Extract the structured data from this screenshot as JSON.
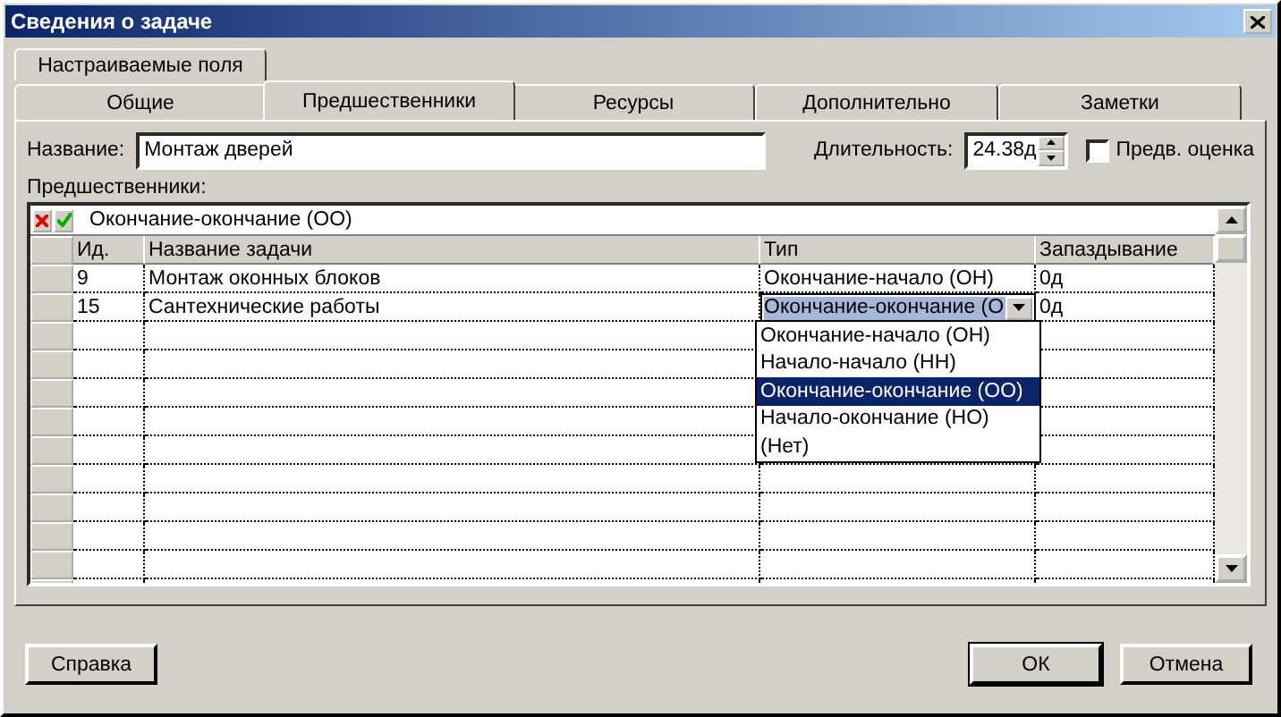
{
  "window": {
    "title": "Сведения о задаче"
  },
  "tabs_back": [
    {
      "label": "Настраиваемые поля",
      "selected": false
    }
  ],
  "tabs": [
    {
      "label": "Общие",
      "selected": false
    },
    {
      "label": "Предшественники",
      "selected": true
    },
    {
      "label": "Ресурсы",
      "selected": false
    },
    {
      "label": "Дополнительно",
      "selected": false
    },
    {
      "label": "Заметки",
      "selected": false
    }
  ],
  "name_field": {
    "label": "Название:",
    "value": "Монтаж дверей"
  },
  "duration_field": {
    "label": "Длительность:",
    "value": "24.38д"
  },
  "estimate_checkbox": {
    "label": "Предв. оценка",
    "checked": false
  },
  "predecessors": {
    "label": "Предшественники:",
    "entry_value": "Окончание-окончание (ОО)",
    "columns": [
      "Ид.",
      "Название задачи",
      "Тип",
      "Запаздывание"
    ],
    "rows": [
      {
        "id": "9",
        "name": "Монтаж оконных блоков",
        "type": "Окончание-начало (ОН)",
        "lag": "0д",
        "editing": false
      },
      {
        "id": "15",
        "name": "Сантехнические работы",
        "type": "Окончание-окончание (О",
        "lag": "0д",
        "editing": true
      }
    ],
    "dropdown": [
      {
        "label": "Окончание-начало (ОН)",
        "selected": false
      },
      {
        "label": "Начало-начало (НН)",
        "selected": false
      },
      {
        "label": "Окончание-окончание (ОО)",
        "selected": true
      },
      {
        "label": "Начало-окончание (НО)",
        "selected": false
      },
      {
        "label": "(Нет)",
        "selected": false
      }
    ]
  },
  "buttons": [
    {
      "label": "Справка",
      "kind": "help"
    },
    {
      "label": "ОК",
      "kind": "default"
    },
    {
      "label": "Отмена",
      "kind": "cancel"
    }
  ]
}
